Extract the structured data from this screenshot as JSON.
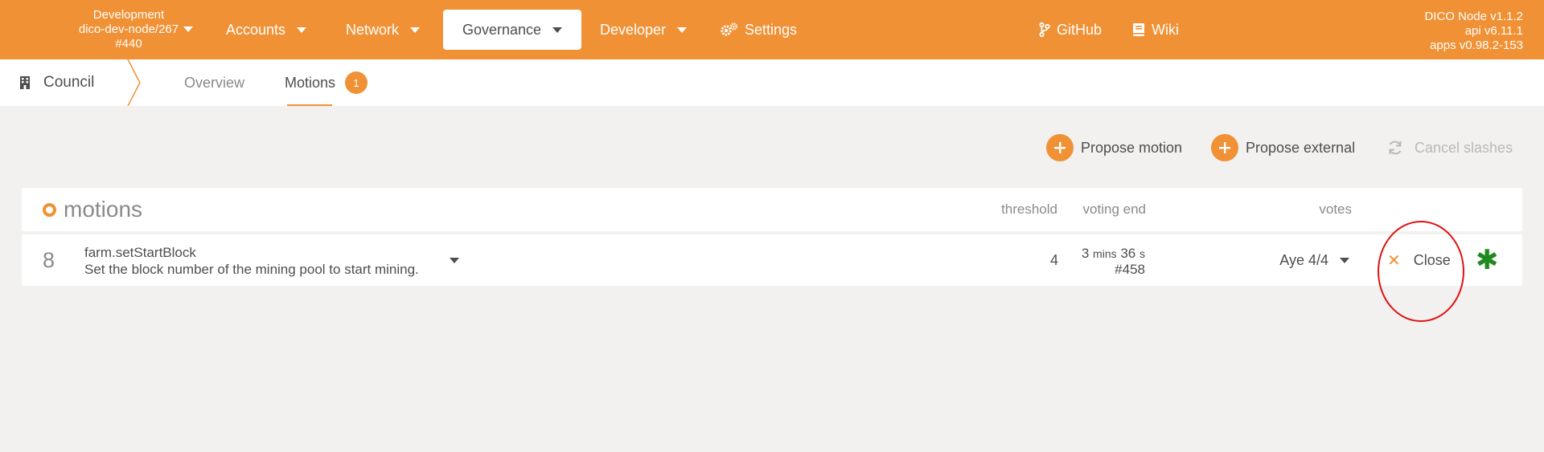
{
  "topbar": {
    "chain": {
      "line1": "Development",
      "line2": "dico-dev-node/267",
      "line3": "#440"
    },
    "nav": {
      "accounts": "Accounts",
      "network": "Network",
      "governance": "Governance",
      "developer": "Developer",
      "settings": "Settings",
      "github": "GitHub",
      "wiki": "Wiki"
    },
    "version": {
      "line1": "DICO Node v1.1.2",
      "line2": "api v6.11.1",
      "line3": "apps v0.98.2-153"
    }
  },
  "subbar": {
    "section": "Council",
    "tabs": {
      "overview": "Overview",
      "motions": "Motions",
      "motions_badge": "1"
    }
  },
  "actions": {
    "propose_motion": "Propose motion",
    "propose_external": "Propose external",
    "cancel_slashes": "Cancel slashes"
  },
  "table": {
    "title": "motions",
    "columns": {
      "threshold": "threshold",
      "voting_end": "voting end",
      "votes": "votes"
    },
    "rows": [
      {
        "index": "8",
        "call": "farm.setStartBlock",
        "description": "Set the block number of the mining pool to start mining.",
        "threshold": "4",
        "voting_end_value": "3",
        "voting_end_unit1": "mins",
        "voting_end_value2": "36",
        "voting_end_unit2": "s",
        "voting_end_block": "#458",
        "votes": "Aye 4/4",
        "close_label": "Close",
        "close_icon": "close-icon",
        "status_icon": "asterisk-icon"
      }
    ]
  },
  "colors": {
    "accent": "#f19135",
    "background": "#f2f1f0",
    "annotation": "#e01010",
    "status_green": "#1f8a1f"
  }
}
